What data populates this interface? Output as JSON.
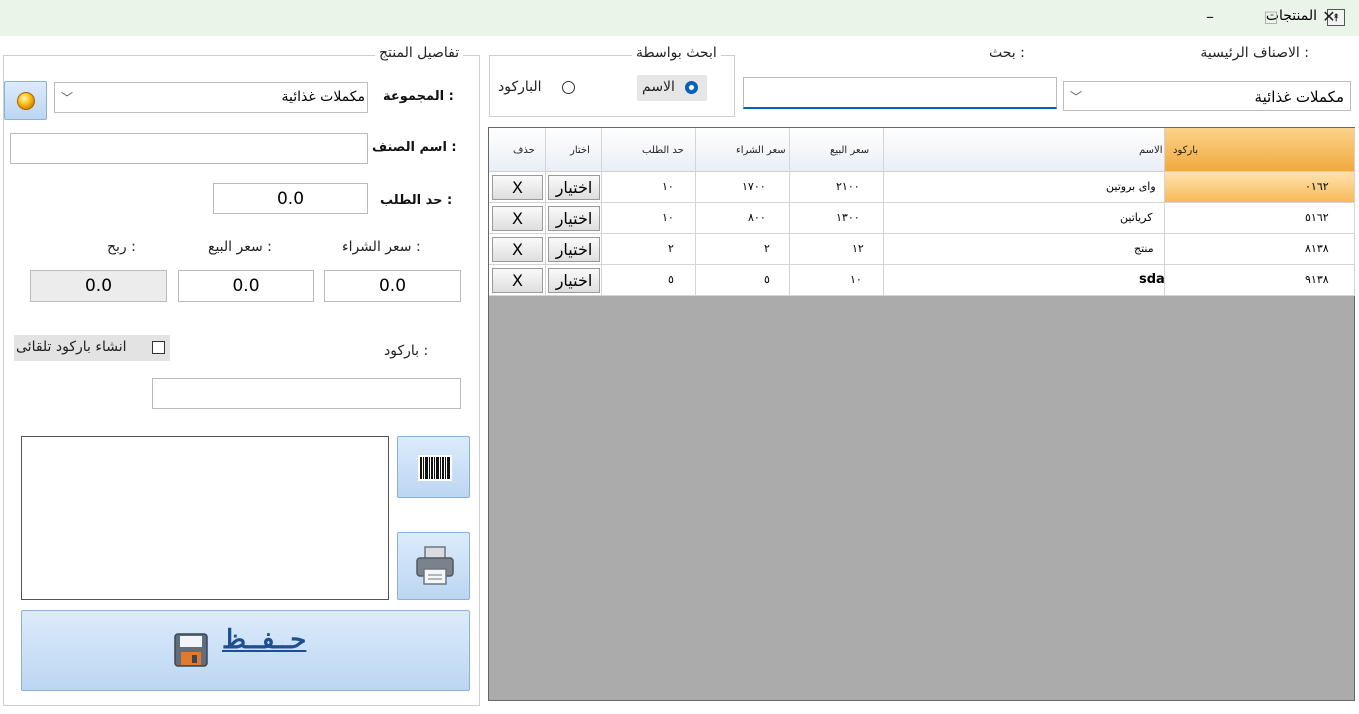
{
  "window": {
    "title": "المنتجات",
    "minimize": "–",
    "maximize": "□",
    "close": "✕",
    "pin_icon": "⯭"
  },
  "search_panel": {
    "main_categories_label": "الاصناف الرئيسية :",
    "category_value": "مكملات غذائية",
    "search_label": "بحث :",
    "search_value": "",
    "search_by_legend": "ابحث بواسطة",
    "by_name_label": "الاسم",
    "by_barcode_label": "الباركود",
    "by_name_selected": true
  },
  "grid": {
    "columns": [
      "باركود",
      "الاسم",
      "سعر البيع",
      "سعر الشراء",
      "حد الطلب",
      "اختار",
      "حذف"
    ],
    "select_label": "اختيار",
    "delete_label": "X",
    "rows": [
      {
        "barcode": "٠١٦٢",
        "name": "واى بروتين",
        "sell": "٢١٠٠",
        "buy": "١٧٠٠",
        "limit": "١٠",
        "selected": true
      },
      {
        "barcode": "٥١٦٢",
        "name": "كرياتين",
        "sell": "١٣٠٠",
        "buy": "٨٠٠",
        "limit": "١٠",
        "selected": false
      },
      {
        "barcode": "٨١٣٨",
        "name": "منتج",
        "sell": "١٢",
        "buy": "٢",
        "limit": "٢",
        "selected": false
      },
      {
        "barcode": "٩١٣٨",
        "name": "sda",
        "sell": "١٠",
        "buy": "٥",
        "limit": "٥",
        "selected": false
      }
    ]
  },
  "details": {
    "legend": "تفاصيل المنتج",
    "group_label": "المجموعة :",
    "group_value": "مكملات غذائية",
    "item_name_label": "اسم الصنف :",
    "item_name_value": "",
    "order_limit_label": "حد الطلب :",
    "order_limit_value": "0.0",
    "buy_price_label": "سعر الشراء :",
    "sell_price_label": "سعر البيع :",
    "profit_label": "ربح :",
    "buy_price_value": "0.0",
    "sell_price_value": "0.0",
    "profit_value": "0.0",
    "barcode_label": "باركود :",
    "barcode_value": "",
    "auto_barcode_label": "انشاء باركود تلقائى",
    "save_label": "حــفــظ"
  },
  "colors": {
    "accent_blue": "#0a5fb8",
    "selected_header": "#f1a83e",
    "button_blue": "#bcd6f2",
    "grid_background": "#ababab"
  },
  "icons": [
    "bulb-icon",
    "barcode-icon",
    "printer-icon",
    "floppy-disk-icon"
  ]
}
